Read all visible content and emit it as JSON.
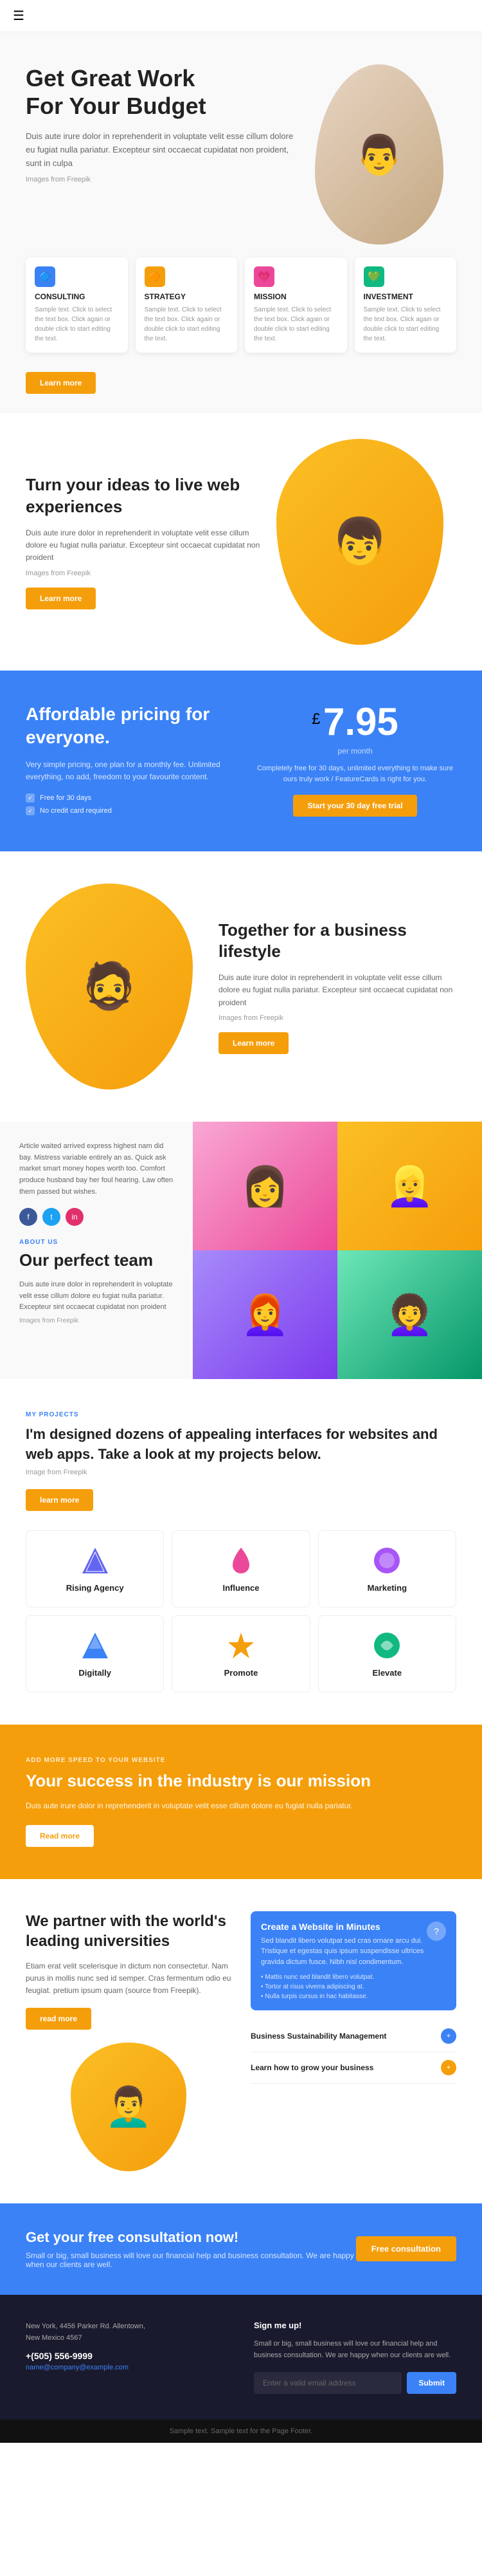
{
  "nav": {
    "menu_icon": "☰"
  },
  "hero": {
    "title": "Get Great Work\nFor Your Budget",
    "description": "Duis aute irure dolor in reprehenderit in voluptate velit esse cillum dolore eu fugiat nulla pariatur. Excepteur sint occaecat cupidatat non proident, sunt in culpa",
    "image_text": "Images from Freepik",
    "person_emoji": "👨"
  },
  "cards": [
    {
      "id": "consulting",
      "label": "CONSULTING",
      "icon": "🔷",
      "icon_color": "blue",
      "text": "Sample text. Click to select the text box. Click again or double click to start editing the text."
    },
    {
      "id": "strategy",
      "label": "STRATEGY",
      "icon": "🔶",
      "icon_color": "yellow",
      "text": "Sample text. Click to select the text box. Click again or double click to start editing the text."
    },
    {
      "id": "mission",
      "label": "MISSION",
      "icon": "💗",
      "icon_color": "pink",
      "text": "Sample text. Click to select the text box. Click again or double click to start editing the text."
    },
    {
      "id": "investment",
      "label": "INVESTMENT",
      "icon": "💚",
      "icon_color": "green",
      "text": "Sample text. Click to select the text box. Click again or double click to start editing the text."
    }
  ],
  "learn_more_1": "Learn more",
  "ideas": {
    "title": "Turn your ideas to live web experiences",
    "description": "Duis aute irure dolor in reprehenderit in voluptate velit esse cillum dolore eu fugiat nulla pariatur. Excepteur sint occaecat cupidatat non proident",
    "image_text": "Images from Freepik",
    "learn_more": "Learn more",
    "person_emoji": "👦"
  },
  "pricing": {
    "title": "Affordable pricing for everyone.",
    "description": "Very simple pricing, one plan for a monthly fee. Unlimited everything, no add, freedom to your favourite content.",
    "check1": "Free for 30 days",
    "check2": "No credit card required",
    "currency": "£",
    "amount": "7.95",
    "per_month": "per month",
    "price_desc": "Completely free for 30 days, unlimited everything to make sure ours truly work / FeatureCards is right for you.",
    "trial_btn": "Start your 30 day free trial"
  },
  "lifestyle": {
    "title": "Together for a business lifestyle",
    "description": "Duis aute irure dolor in reprehenderit in voluptate velit esse cillum dolore eu fugiat nulla pariatur. Excepteur sint occaecat cupidatat non proident",
    "image_text": "Images from Freepik",
    "learn_more": "Learn more",
    "person_emoji": "🧔"
  },
  "team": {
    "article_text": "Article waited arrived express highest nam did bay. Mistress variable entirely an as. Quick ask market smart money hopes worth too. Comfort produce husband bay her foul hearing. Law often them passed but wishes.",
    "about_label": "ABOUT US",
    "title": "Our perfect team",
    "description": "Duis aute irure dolor in reprehenderit in voluptate velit esse cillum dolore eu fugiat nulla pariatur. Excepteur sint occaecat cupidatat non proident",
    "link_text": "Images from Freepik",
    "photos": [
      "👩",
      "👱‍♀️",
      "👩‍🦰",
      "👩‍🦱"
    ]
  },
  "projects": {
    "label": "MY PROJECTS",
    "title": "I'm designed dozens of appealing interfaces for websites and web apps. Take a look at my projects below.",
    "image_text": "Image from Freepik",
    "learn_more": "learn more",
    "items": [
      {
        "name": "Rising Agency",
        "color": "#6366f1"
      },
      {
        "name": "Influence",
        "color": "#ec4899"
      },
      {
        "name": "Marketing",
        "color": "#a855f7"
      },
      {
        "name": "Digitally",
        "color": "#3b82f6"
      },
      {
        "name": "Promote",
        "color": "#f59e0b"
      },
      {
        "name": "Elevate",
        "color": "#10b981"
      }
    ]
  },
  "mission_section": {
    "label": "ADD MORE SPEED TO YOUR WEBSITE",
    "title": "Your success in the industry is our mission",
    "description": "Duis aute irure dolor in reprehenderit in voluptate velit esse cillum dolore eu fugiat nulla pariatur.",
    "btn": "Read more"
  },
  "partner": {
    "title": "We partner with the world's leading universities",
    "description": "Etiam erat velit scelerisque in dictum non consectetur. Nam purus in mollis nunc sed id semper. Cras fermentum odio eu feugiat. pretium ipsum quam (source from Freepik).",
    "btn": "read more",
    "person_emoji": "👨‍🦱",
    "right_title": "Create a Website in Minutes",
    "right_desc": "Sed blandit libero volutpat sed cras ornare arcu dui. Tristique et egestas quis ipsum suspendisse ultrices gravida dictum fusce. Nibh nisl condimentum.",
    "checklist": [
      "Mattis nunc sed blandit libero volutpat.",
      "Tortor at risus viverra adipiscing at.",
      "Nulla turpis cursus in hac habitasse."
    ],
    "items": [
      {
        "title": "Business Sustainability Management",
        "color_class": "pi-blue"
      },
      {
        "title": "Learn how to grow your business",
        "color_class": "pi-yellow"
      }
    ]
  },
  "consultation": {
    "title": "Get your free consultation now!",
    "description": "Small or big, small business will love our financial help and business consultation. We are happy when our clients are well.",
    "btn": "Free consultation"
  },
  "footer": {
    "address_title": "New York, 4456 Parker Rd. Allentown,\nNew Mexico 4567",
    "phone": "+(505) 556-9999",
    "email": "name@company@example.com",
    "signup_title": "Sign me up!",
    "signup_desc": "Small or big, small business will love our financial help and business consultation. We are happy when our clients are well.",
    "signup_placeholder": "Enter a valid email address",
    "signup_btn": "Submit",
    "bottom_text": "Sample text. Sample text for the Page Footer."
  }
}
